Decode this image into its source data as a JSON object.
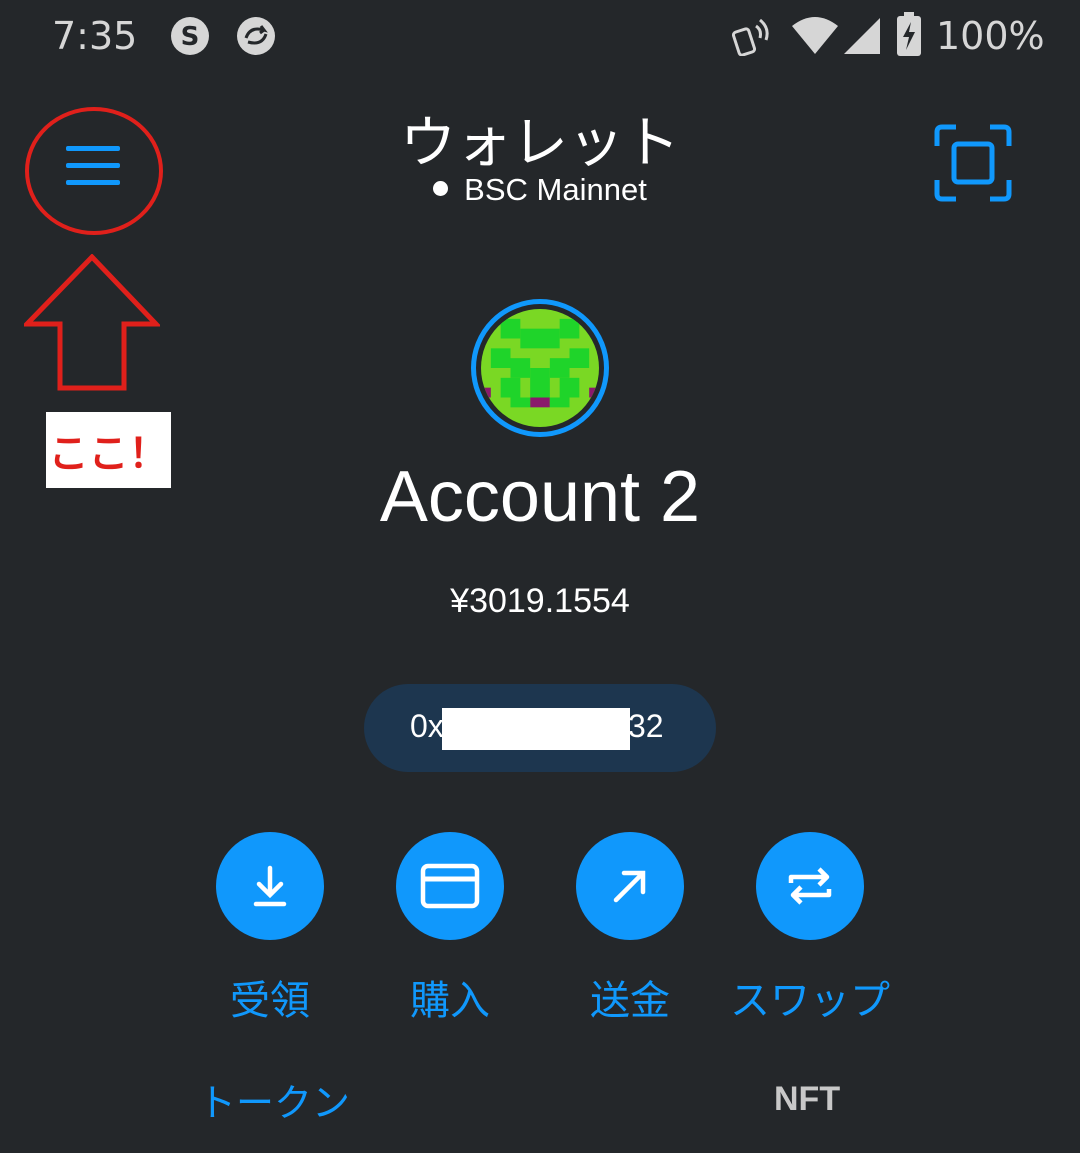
{
  "status_bar": {
    "time": "7:35",
    "battery": "100%",
    "icons": [
      "s-app-icon",
      "sync-app-icon",
      "nfc-icon",
      "wifi-icon",
      "cell-signal-icon",
      "battery-charging-icon"
    ]
  },
  "header": {
    "title": "ウォレット",
    "network": "BSC Mainnet",
    "menu_icon": "hamburger-menu-icon",
    "scan_icon": "qr-scan-icon"
  },
  "annotation": {
    "label": "ここ！",
    "color": "#e0201b"
  },
  "account": {
    "name": "Account 2",
    "balance": "¥3019.1554",
    "address_start": "0x",
    "address_end": "32"
  },
  "actions": [
    {
      "label": "受領",
      "icon": "download-icon"
    },
    {
      "label": "購入",
      "icon": "card-icon"
    },
    {
      "label": "送金",
      "icon": "arrow-up-right-icon"
    },
    {
      "label": "スワップ",
      "icon": "swap-arrows-icon"
    }
  ],
  "tabs": [
    {
      "label": "トークン",
      "active": true
    },
    {
      "label": "NFT",
      "active": false
    }
  ],
  "colors": {
    "background": "#24272a",
    "accent": "#1098fc",
    "address_pill": "#1d364f"
  }
}
